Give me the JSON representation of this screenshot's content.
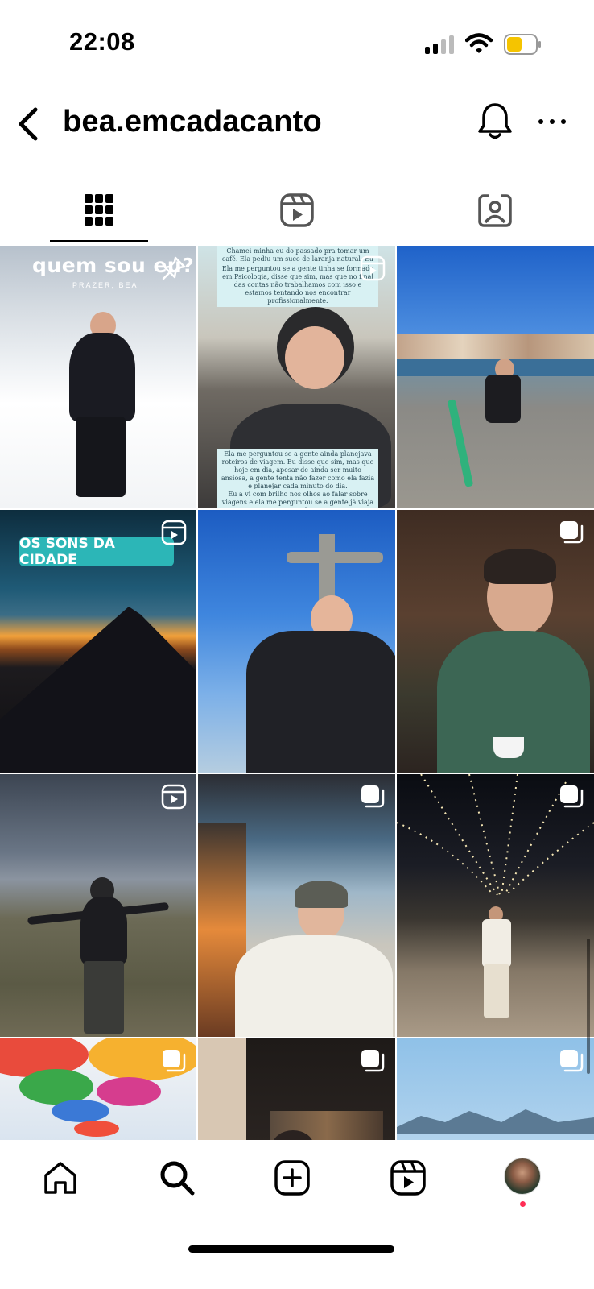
{
  "status_bar": {
    "time": "22:08",
    "signal_icon": "cellular-signal-icon",
    "wifi_icon": "wifi-icon",
    "battery_icon": "battery-icon",
    "battery_color": "#f5c400"
  },
  "header": {
    "username": "bea.emcadacanto",
    "back_icon": "chevron-left-icon",
    "bell_icon": "bell-icon",
    "more_icon": "more-horizontal-icon"
  },
  "tabs": [
    {
      "name": "posts",
      "icon": "grid-icon",
      "active": true
    },
    {
      "name": "reels",
      "icon": "reels-icon",
      "active": false
    },
    {
      "name": "tagged",
      "icon": "tagged-person-icon",
      "active": false
    }
  ],
  "grid": {
    "tiles": [
      {
        "badge": "pin-icon",
        "overlay_title": "quem sou eu?",
        "overlay_subtitle": "PRAZER, BEA"
      },
      {
        "badge": "reel-icon"
      },
      {
        "badge": null
      },
      {
        "badge": "reel-icon",
        "banner_text": "OS SONS DA CIDADE"
      },
      {
        "badge": null
      },
      {
        "badge": "carousel-icon"
      },
      {
        "badge": "reel-icon"
      },
      {
        "badge": "carousel-icon"
      },
      {
        "badge": "carousel-icon"
      },
      {
        "badge": "carousel-icon"
      },
      {
        "badge": "carousel-icon"
      },
      {
        "badge": "carousel-icon"
      }
    ],
    "story_text_top": "Chamei minha eu do passado pra tomar um café. Ela pediu um suco de laranja natural. Eu também.",
    "story_text_mid": "Ela me perguntou se a gente tinha se formado em Psicologia, disse que sim, mas que no final das contas não trabalhamos com isso e estamos tentando nos encontrar profissionalmente.",
    "story_text_low": "Ela me perguntou se a gente ainda planejava roteiros de viagem. Eu disse que sim, mas que hoje em dia, apesar de ainda ser muito ansiosa, a gente tenta não fazer como ela fazia e planejar cada minuto do dia.",
    "story_text_bottom": "Eu a vi com brilho nos olhos ao falar sobre viagens e ela me perguntou se a gente já viaja o mundo."
  },
  "bottom_nav": {
    "items": [
      {
        "name": "home",
        "icon": "home-icon"
      },
      {
        "name": "search",
        "icon": "search-icon"
      },
      {
        "name": "create",
        "icon": "add-square-icon"
      },
      {
        "name": "reels",
        "icon": "reels-icon"
      },
      {
        "name": "profile",
        "icon": "profile-avatar-icon"
      }
    ],
    "notification_color": "#ff2d55"
  }
}
